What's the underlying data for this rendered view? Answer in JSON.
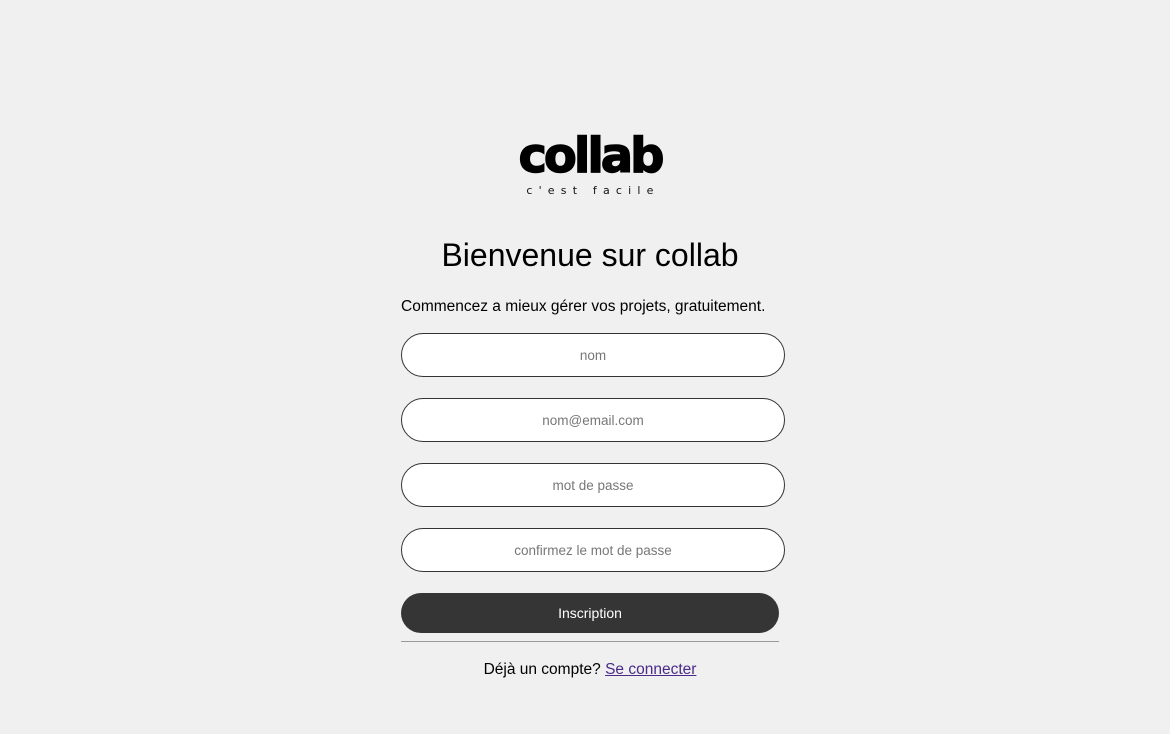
{
  "logo": {
    "word": "collab",
    "tagline": "c'est facile"
  },
  "heading": {
    "title": "Bienvenue sur collab",
    "subtitle": "Commencez a mieux gérer vos projets, gratuitement."
  },
  "form": {
    "name_placeholder": "nom",
    "email_placeholder": "nom@email.com",
    "password_placeholder": "mot de passe",
    "confirm_placeholder": "confirmez le mot de passe",
    "submit_label": "Inscription"
  },
  "footer": {
    "prompt": "Déjà un compte?",
    "login_link": "Se connecter"
  },
  "colors": {
    "background": "#eff0ef",
    "button": "#353535",
    "link": "#4b2a8a"
  }
}
